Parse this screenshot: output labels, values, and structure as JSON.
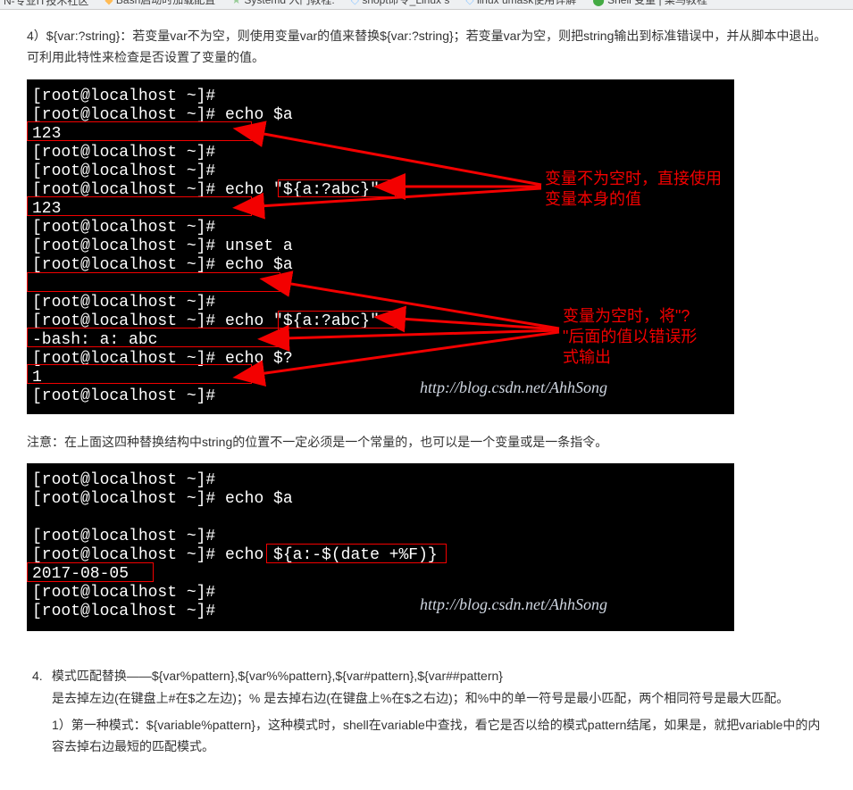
{
  "tabs": {
    "t1": "N-专业IT技术社区",
    "t2": "Bash启动时加载配置",
    "t3": "Systemd 入门教程:",
    "t4": "shopt命令_Linux s",
    "t5": "linux umask使用详解",
    "t6": "Shell 变量 | 菜鸟教程"
  },
  "intro": {
    "p1": "4）${var:?string}：若变量var不为空，则使用变量var的值来替换${var:?string}；若变量var为空，则把string输出到标准错误中，并从脚本中退出。可利用此特性来检查是否设置了变量的值。"
  },
  "term1": {
    "l1": "[root@localhost ~]#",
    "l2": "[root@localhost ~]# echo $a",
    "l3": "123",
    "l4": "[root@localhost ~]#",
    "l5": "[root@localhost ~]#",
    "l6a": "[root@localhost ~]# echo ",
    "l6b": "\"${a:?abc}\"",
    "l7": "123",
    "l8": "[root@localhost ~]#",
    "l9": "[root@localhost ~]# unset a",
    "l10": "[root@localhost ~]# echo $a",
    "l11": " ",
    "l12": "[root@localhost ~]#",
    "l13a": "[root@localhost ~]# echo ",
    "l13b": "\"${a:?abc}\"",
    "l14": "-bash: a: abc",
    "l15": "[root@localhost ~]# echo $?",
    "l16": "1",
    "l17": "[root@localhost ~]#",
    "ann1a": "变量不为空时，直接使用",
    "ann1b": "变量本身的值",
    "ann2a": "变量为空时，将\"?",
    "ann2b": "\"后面的值以错误形",
    "ann2c": "式输出",
    "water": "http://blog.csdn.net/AhhSong"
  },
  "note": "注意：在上面这四种替换结构中string的位置不一定必须是一个常量的，也可以是一个变量或是一条指令。",
  "term2": {
    "l1": "[root@localhost ~]#",
    "l2": "[root@localhost ~]# echo $a",
    "l3": " ",
    "l4": "[root@localhost ~]#",
    "l5a": "[root@localhost ~]# echo ",
    "l5b": "${a:-$(date +%F)}",
    "l6": "2017-08-05",
    "l7": "[root@localhost ~]#",
    "l8": "[root@localhost ~]#",
    "water": "http://blog.csdn.net/AhhSong"
  },
  "section4": {
    "num": "4.",
    "title": "模式匹配替换——${var%pattern},${var%%pattern},${var#pattern},${var##pattern}",
    "p1": "是去掉左边(在键盘上#在$之左边)；% 是去掉右边(在键盘上%在$之右边)；和%中的单一符号是最小匹配，两个相同符号是最大匹配。",
    "p2": "1）第一种模式：${variable%pattern}，这种模式时，shell在variable中查找，看它是否以给的模式pattern结尾，如果是，就把variable中的内容去掉右边最短的匹配模式。"
  }
}
